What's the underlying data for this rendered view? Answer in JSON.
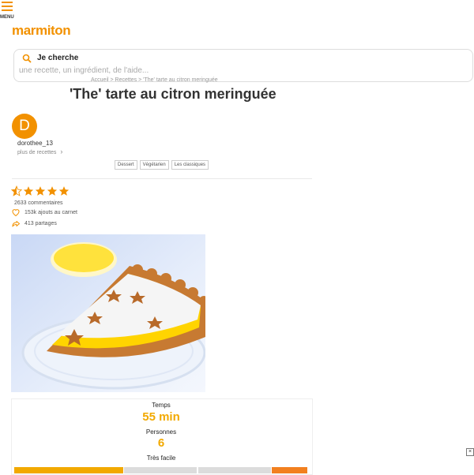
{
  "header": {
    "menu_label": "MENU",
    "logo_text": "marmiton",
    "brand_color": "#f29100"
  },
  "search": {
    "title": "Je cherche",
    "placeholder": "une recette, un ingrédient, de l'aide..."
  },
  "breadcrumb": "Accueil > Recettes > 'The' tarte au citron meringuée",
  "recipe": {
    "title": "'The' tarte au citron meringuée",
    "author_initial": "D",
    "author": "dorothee_13",
    "more_recipes": "plus de recettes",
    "tags": [
      "Dessert",
      "Végétarien",
      "Les classiques"
    ],
    "rating_stars": 4.5,
    "comments": "2633 commentaires",
    "carnet": "153k ajouts au carnet",
    "partages": "413 partages"
  },
  "info": {
    "time_label": "Temps",
    "time_value": "55 min",
    "people_label": "Personnes",
    "people_value": "6",
    "difficulty": "Très facile"
  },
  "icons": {
    "menu": "hamburger-icon",
    "search": "search-icon",
    "heart": "heart-icon",
    "share": "share-icon",
    "star": "star-icon",
    "close": "close-icon"
  }
}
